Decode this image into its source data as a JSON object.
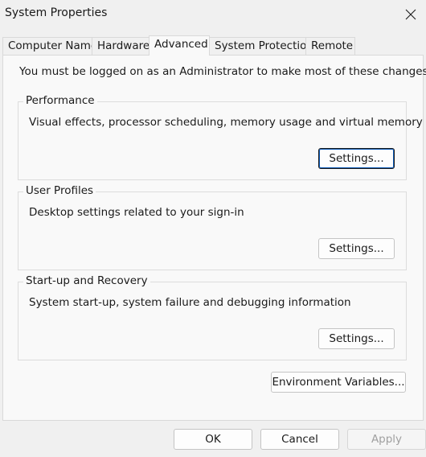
{
  "window": {
    "title": "System Properties"
  },
  "tabs": [
    {
      "label": "Computer Name"
    },
    {
      "label": "Hardware"
    },
    {
      "label": "Advanced"
    },
    {
      "label": "System Protection"
    },
    {
      "label": "Remote"
    }
  ],
  "active_tab": "Advanced",
  "admin_note": "You must be logged on as an Administrator to make most of these changes.",
  "groups": {
    "performance": {
      "title": "Performance",
      "description": "Visual effects, processor scheduling, memory usage and virtual memory",
      "button": "Settings..."
    },
    "user_profiles": {
      "title": "User Profiles",
      "description": "Desktop settings related to your sign-in",
      "button": "Settings..."
    },
    "startup": {
      "title": "Start-up and Recovery",
      "description": "System start-up, system failure and debugging information",
      "button": "Settings..."
    }
  },
  "env_button": "Environment Variables...",
  "footer": {
    "ok": "OK",
    "cancel": "Cancel",
    "apply": "Apply"
  },
  "icons": {
    "close": "close-icon"
  },
  "colors": {
    "focus_accent": "#0a58b5",
    "panel_bg": "#f9f9f9",
    "window_bg": "#f0f0f0"
  }
}
